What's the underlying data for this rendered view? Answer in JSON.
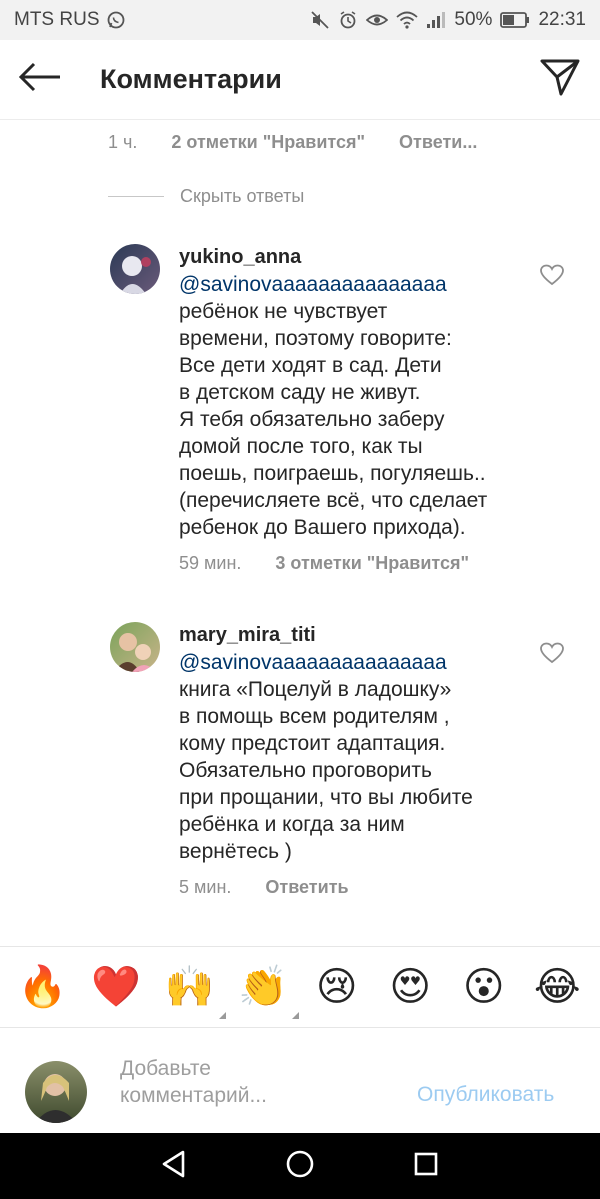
{
  "status_bar": {
    "carrier": "MTS RUS",
    "battery_percent": "50%",
    "time": "22:31"
  },
  "header": {
    "title": "Комментарии"
  },
  "thread": {
    "parent_meta": {
      "time": "1 ч.",
      "likes": "2 отметки \"Нравится\"",
      "reply": "Ответи..."
    },
    "hide_replies": "Скрыть ответы"
  },
  "comments": [
    {
      "username": "yukino_anna",
      "mention": "@savinovaaaaaaaaaaaaaaa",
      "text": "ребёнок не чувствует\nвремени, поэтому говорите:\nВсе дети ходят в сад. Дети\nв детском саду не живут.\nЯ тебя обязательно заберу\nдомой после того, как ты\nпоешь, поиграешь, погуляешь..\n(перечисляете всё, что сделает\nребенок до Вашего прихода).",
      "time": "59 мин.",
      "likes": "3 отметки \"Нравится\""
    },
    {
      "username": "mary_mira_titi",
      "mention": "@savinovaaaaaaaaaaaaaaa",
      "text": "книга «Поцелуй в ладошку»\nв помощь всем родителям ,\nкому предстоит адаптация.\nОбязательно проговорить\nпри прощании, что вы любите\nребёнка и когда за ним\nвернётесь )",
      "time": "5 мин.",
      "reply": "Ответить"
    }
  ],
  "emoji_bar": {
    "items": [
      "🔥",
      "❤️",
      "🙌",
      "👏",
      "😢",
      "😍",
      "😮",
      "😂"
    ]
  },
  "composer": {
    "placeholder": "Добавьте\nкомментарий...",
    "publish_label": "Опубликовать"
  },
  "colors": {
    "mention": "#003569",
    "secondary_text": "#8e8e8e",
    "publish_disabled": "#9ccbf1"
  }
}
